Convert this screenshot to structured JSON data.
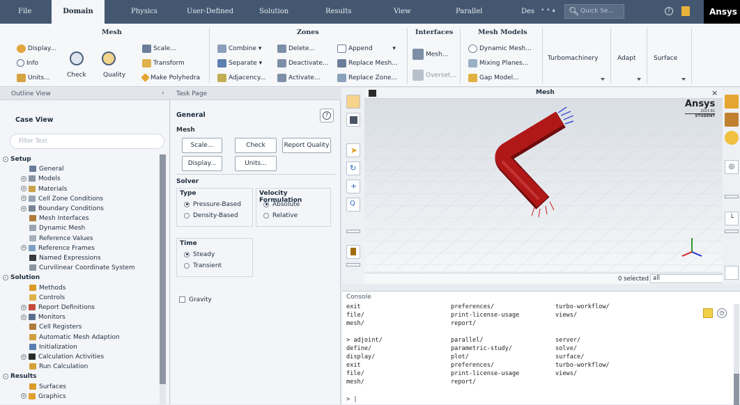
{
  "menubar": {
    "items": [
      "File",
      "Domain",
      "Physics",
      "User-Defined",
      "Solution",
      "Results",
      "View",
      "Parallel",
      "Des"
    ],
    "active": "Domain",
    "quick_search_placeholder": "Quick Se...",
    "brand": "Ansys"
  },
  "ribbon": {
    "mesh": {
      "title": "Mesh",
      "display": "Display...",
      "info": "Info",
      "units": "Units...",
      "check": "Check",
      "quality": "Quality",
      "scale": "Scale...",
      "transform": "Transform",
      "make_polyhedra": "Make Polyhedra"
    },
    "zones": {
      "title": "Zones",
      "combine": "Combine",
      "separate": "Separate",
      "adjacency": "Adjacency...",
      "delete": "Delete...",
      "deactivate": "Deactivate...",
      "activate": "Activate...",
      "append": "Append",
      "replace_mesh": "Replace Mesh...",
      "replace_zone": "Replace Zone..."
    },
    "interfaces": {
      "title": "Interfaces",
      "mesh": "Mesh...",
      "overset": "Overset..."
    },
    "mesh_models": {
      "title": "Mesh Models",
      "dynamic_mesh": "Dynamic Mesh...",
      "mixing_planes": "Mixing Planes...",
      "gap_model": "Gap Model..."
    },
    "turbomachinery": "Turbomachinery",
    "adapt": "Adapt",
    "surface": "Surface"
  },
  "outline": {
    "title": "Outline View",
    "case_view": "Case View",
    "filter_placeholder": "Filter Text",
    "items": [
      {
        "label": "Setup",
        "level": 0,
        "exp": "-",
        "section": true
      },
      {
        "label": "General",
        "level": 1,
        "exp": "",
        "icon": "#6a7e99"
      },
      {
        "label": "Models",
        "level": 1,
        "exp": "+",
        "icon": "#8a95a3"
      },
      {
        "label": "Materials",
        "level": 1,
        "exp": "+",
        "icon": "#c8a34a"
      },
      {
        "label": "Cell Zone Conditions",
        "level": 1,
        "exp": "+",
        "icon": "#9aa4b2"
      },
      {
        "label": "Boundary Conditions",
        "level": 1,
        "exp": "+",
        "icon": "#7a8697"
      },
      {
        "label": "Mesh Interfaces",
        "level": 1,
        "exp": "",
        "icon": "#b07a3a"
      },
      {
        "label": "Dynamic Mesh",
        "level": 1,
        "exp": "",
        "icon": "#9aa4b2"
      },
      {
        "label": "Reference Values",
        "level": 1,
        "exp": "",
        "icon": "#a8b1bd"
      },
      {
        "label": "Reference Frames",
        "level": 1,
        "exp": "+",
        "icon": "#7fa0c4"
      },
      {
        "label": "Named Expressions",
        "level": 1,
        "exp": "",
        "icon": "#3a3a3a"
      },
      {
        "label": "Curvilinear Coordinate System",
        "level": 1,
        "exp": "",
        "icon": "#8a95a3"
      },
      {
        "label": "Solution",
        "level": 0,
        "exp": "-",
        "section": true
      },
      {
        "label": "Methods",
        "level": 1,
        "exp": "",
        "icon": "#d99b2b"
      },
      {
        "label": "Controls",
        "level": 1,
        "exp": "",
        "icon": "#e0b04a"
      },
      {
        "label": "Report Definitions",
        "level": 1,
        "exp": "+",
        "icon": "#c44a3a"
      },
      {
        "label": "Monitors",
        "level": 1,
        "exp": "+",
        "icon": "#5a6e8a"
      },
      {
        "label": "Cell Registers",
        "level": 1,
        "exp": "",
        "icon": "#b07a3a"
      },
      {
        "label": "Automatic Mesh Adaption",
        "level": 1,
        "exp": "",
        "icon": "#d0a040"
      },
      {
        "label": "Initialization",
        "level": 1,
        "exp": "",
        "icon": "#5a7fb0"
      },
      {
        "label": "Calculation Activities",
        "level": 1,
        "exp": "+",
        "icon": "#2b2b2b"
      },
      {
        "label": "Run Calculation",
        "level": 1,
        "exp": "",
        "icon": "#d4a238"
      },
      {
        "label": "Results",
        "level": 0,
        "exp": "-",
        "section": true
      },
      {
        "label": "Surfaces",
        "level": 1,
        "exp": "",
        "icon": "#d99b2b"
      },
      {
        "label": "Graphics",
        "level": 1,
        "exp": "+",
        "icon": "#e0a030"
      }
    ]
  },
  "task": {
    "title": "Task Page",
    "general": "General",
    "mesh_label": "Mesh",
    "scale_btn": "Scale...",
    "check_btn": "Check",
    "report_quality_btn": "Report Quality",
    "display_btn": "Display...",
    "units_btn": "Units...",
    "solver_label": "Solver",
    "type_label": "Type",
    "pressure_based": "Pressure-Based",
    "density_based": "Density-Based",
    "velocity_label": "Velocity Formulation",
    "absolute": "Absolute",
    "relative": "Relative",
    "time_label": "Time",
    "steady": "Steady",
    "transient": "Transient",
    "gravity": "Gravity"
  },
  "graphics": {
    "title": "Mesh",
    "brand": "Ansys",
    "version": "2023 R1",
    "edition": "STUDENT",
    "selected": "0 selected",
    "filter_value": "all"
  },
  "console": {
    "title": "Console",
    "lines": [
      [
        "exit",
        "preferences/",
        "turbo-workflow/"
      ],
      [
        "file/",
        "print-license-usage",
        "views/"
      ],
      [
        "mesh/",
        "report/",
        ""
      ],
      [
        "",
        "",
        ""
      ],
      [
        "> adjoint/",
        "  parallel/",
        "  server/"
      ],
      [
        "define/",
        "parametric-study/",
        "solve/"
      ],
      [
        "display/",
        "plot/",
        "surface/"
      ],
      [
        "exit",
        "preferences/",
        "turbo-workflow/"
      ],
      [
        "file/",
        "print-license-usage",
        "views/"
      ],
      [
        "mesh/",
        "report/",
        ""
      ]
    ],
    "prompt": "> |"
  },
  "colors": {
    "menubar_bg": "#445770",
    "pipe": "#b01818",
    "inlet_arrows": "#2030d0"
  }
}
